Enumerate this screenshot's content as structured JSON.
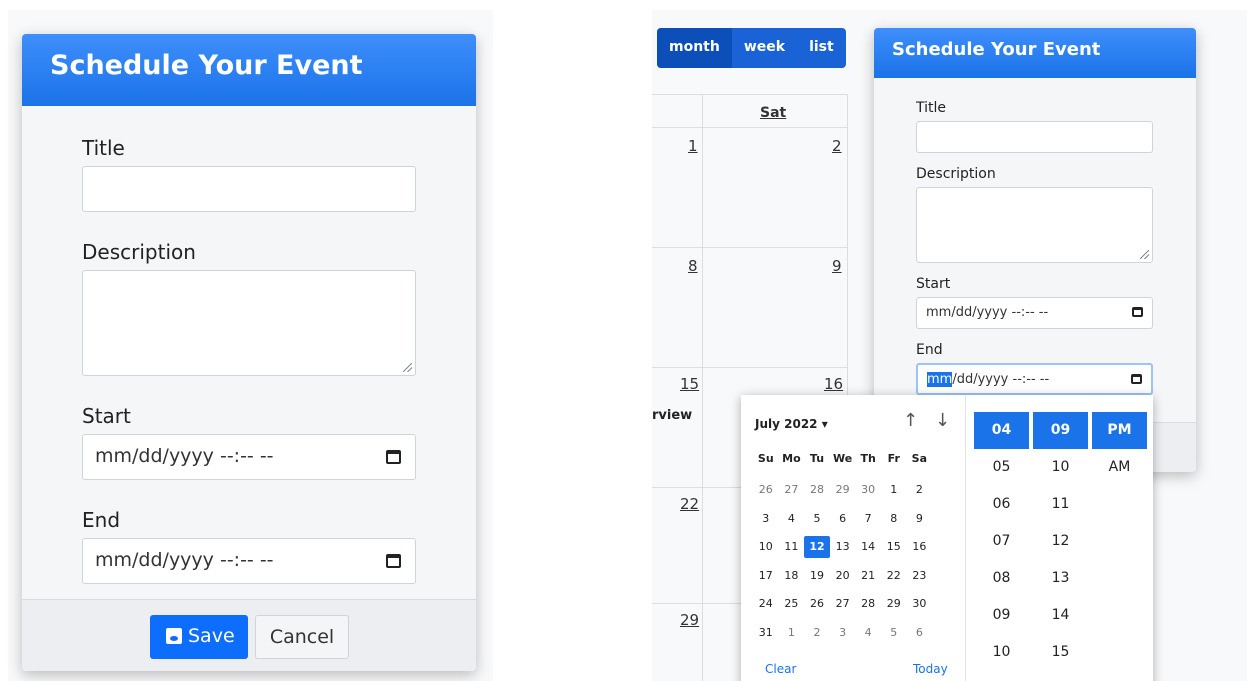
{
  "left_modal": {
    "title": "Schedule Your Event",
    "labels": {
      "title": "Title",
      "description": "Description",
      "start": "Start",
      "end": "End"
    },
    "start_placeholder": "mm/dd/yyyy --:-- --",
    "end_placeholder": "mm/dd/yyyy --:-- --",
    "save_label": "Save",
    "cancel_label": "Cancel"
  },
  "right": {
    "view_buttons": [
      "month",
      "week",
      "list"
    ],
    "sat_header": "Sat",
    "days": [
      "1",
      "2",
      "8",
      "9",
      "15",
      "16",
      "22",
      "29"
    ],
    "event_fragment": "rview",
    "modal": {
      "title": "Schedule Your Event",
      "labels": {
        "title": "Title",
        "description": "Description",
        "start": "Start",
        "end": "End"
      },
      "start_placeholder": "mm/dd/yyyy --:-- --",
      "end_mm": "mm",
      "end_rest": "/dd/yyyy --:-- --"
    },
    "picker": {
      "month_label": "July 2022 ▾",
      "up_arrow": "↑",
      "down_arrow": "↓",
      "weekdays": [
        "Su",
        "Mo",
        "Tu",
        "We",
        "Th",
        "Fr",
        "Sa"
      ],
      "weeks": [
        [
          "26",
          "27",
          "28",
          "29",
          "30",
          "1",
          "2"
        ],
        [
          "3",
          "4",
          "5",
          "6",
          "7",
          "8",
          "9"
        ],
        [
          "10",
          "11",
          "12",
          "13",
          "14",
          "15",
          "16"
        ],
        [
          "17",
          "18",
          "19",
          "20",
          "21",
          "22",
          "23"
        ],
        [
          "24",
          "25",
          "26",
          "27",
          "28",
          "29",
          "30"
        ],
        [
          "31",
          "1",
          "2",
          "3",
          "4",
          "5",
          "6"
        ]
      ],
      "clear_label": "Clear",
      "today_label": "Today",
      "hours": [
        "04",
        "05",
        "06",
        "07",
        "08",
        "09",
        "10"
      ],
      "minutes": [
        "09",
        "10",
        "11",
        "12",
        "13",
        "14",
        "15"
      ],
      "ampm": [
        "PM",
        "AM"
      ]
    }
  }
}
